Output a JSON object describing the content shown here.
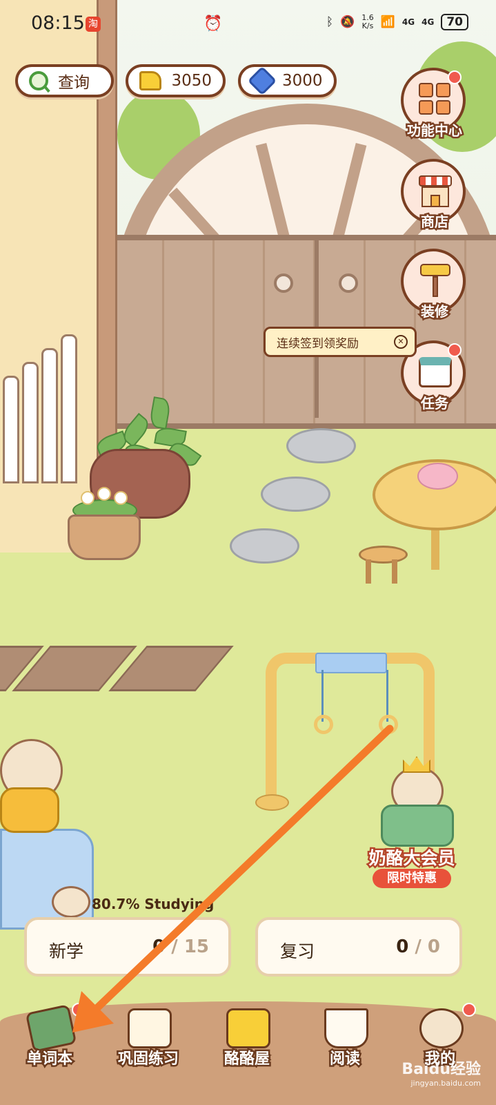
{
  "status_bar": {
    "time": "08:15",
    "net_speed_value": "1.6",
    "net_speed_unit": "K/s",
    "signal1": "4G",
    "signal2": "4G",
    "battery": "70"
  },
  "top_bar": {
    "search_label": "查询",
    "cheese_count": "3050",
    "gem_count": "3000"
  },
  "side_menu": [
    {
      "label": "功能中心",
      "icon": "grid-icon",
      "badge": true
    },
    {
      "label": "商店",
      "icon": "shop-icon",
      "badge": false
    },
    {
      "label": "装修",
      "icon": "paint-roller-icon",
      "badge": false
    },
    {
      "label": "任务",
      "icon": "calendar-icon",
      "badge": true
    }
  ],
  "tooltip": {
    "text": "连续签到领奖励"
  },
  "promo": {
    "title": "奶酪大会员",
    "badge": "限时特惠"
  },
  "progress": {
    "label": "80.7% Studying"
  },
  "cards": {
    "new": {
      "title": "新学",
      "done": "0",
      "sep": "/",
      "total": "15"
    },
    "review": {
      "title": "复习",
      "done": "0",
      "sep": "/",
      "total": "0"
    }
  },
  "bottom_nav": [
    {
      "label": "单词本",
      "icon": "vocab-book-icon",
      "badge": true
    },
    {
      "label": "巩固练习",
      "icon": "notebook-icon",
      "badge": false
    },
    {
      "label": "酪酪屋",
      "icon": "cheese-house-icon",
      "badge": false
    },
    {
      "label": "阅读",
      "icon": "open-book-icon",
      "badge": false
    },
    {
      "label": "我的",
      "icon": "hamster-avatar-icon",
      "badge": true
    }
  ],
  "watermark": {
    "brand": "Baidu经验",
    "url": "jingyan.baidu.com"
  },
  "colors": {
    "accent_brown": "#7a3f22",
    "badge_red": "#f05b4e",
    "grass": "#dfe99a",
    "arrow": "#f47b2a"
  }
}
